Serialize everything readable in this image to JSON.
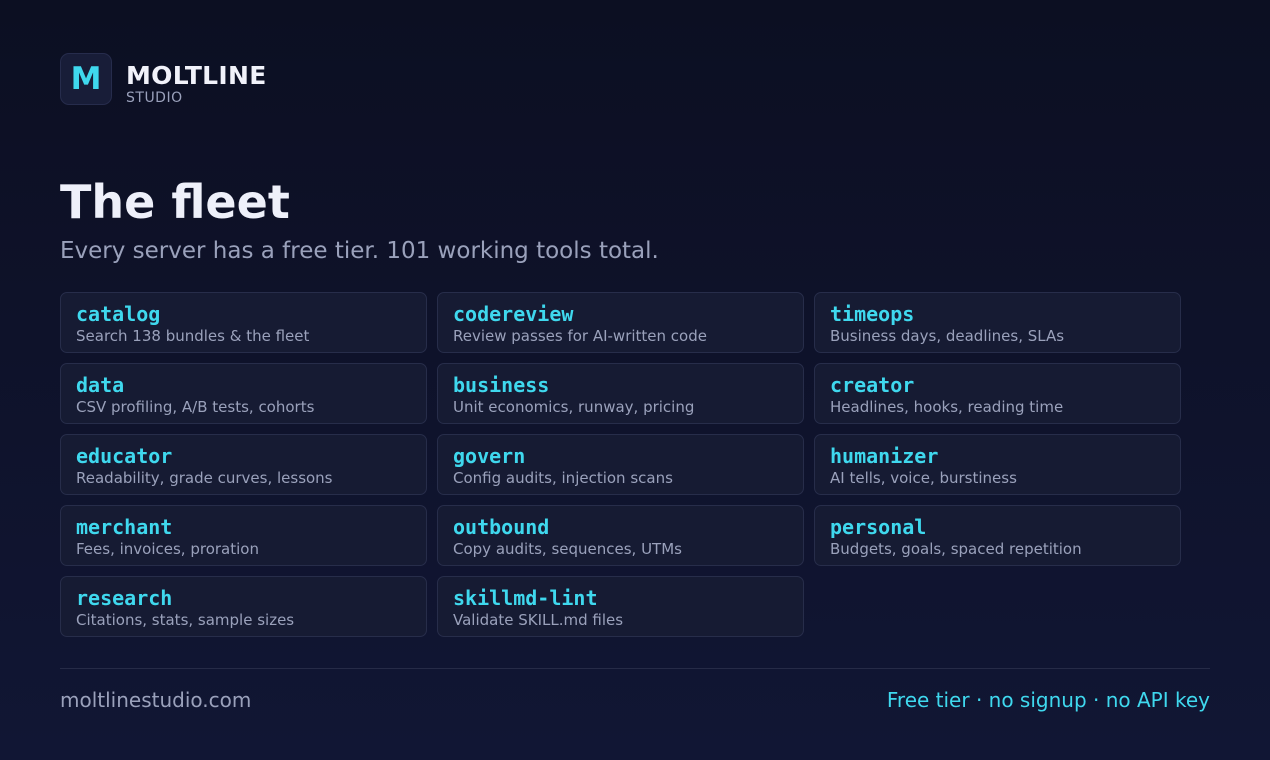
{
  "brand": {
    "logo_letter": "M",
    "name": "MOLTLINE",
    "subname": "STUDIO"
  },
  "page": {
    "title": "The fleet",
    "subtitle": "Every server has a free tier. 101 working tools total."
  },
  "servers": [
    {
      "name": "catalog",
      "desc": "Search 138 bundles & the fleet"
    },
    {
      "name": "codereview",
      "desc": "Review passes for AI-written code"
    },
    {
      "name": "timeops",
      "desc": "Business days, deadlines, SLAs"
    },
    {
      "name": "data",
      "desc": "CSV profiling, A/B tests, cohorts"
    },
    {
      "name": "business",
      "desc": "Unit economics, runway, pricing"
    },
    {
      "name": "creator",
      "desc": "Headlines, hooks, reading time"
    },
    {
      "name": "educator",
      "desc": "Readability, grade curves, lessons"
    },
    {
      "name": "govern",
      "desc": "Config audits, injection scans"
    },
    {
      "name": "humanizer",
      "desc": "AI tells, voice, burstiness"
    },
    {
      "name": "merchant",
      "desc": "Fees, invoices, proration"
    },
    {
      "name": "outbound",
      "desc": "Copy audits, sequences, UTMs"
    },
    {
      "name": "personal",
      "desc": "Budgets, goals, spaced repetition"
    },
    {
      "name": "research",
      "desc": "Citations, stats, sample sizes"
    },
    {
      "name": "skillmd-lint",
      "desc": "Validate SKILL.md files"
    }
  ],
  "footer": {
    "url": "moltlinestudio.com",
    "tagline": "Free tier · no signup · no API key"
  },
  "colors": {
    "accent": "#3fd8ee",
    "background": "#0f1330",
    "card": "#161b33",
    "muted_text": "#9aa1bb"
  }
}
